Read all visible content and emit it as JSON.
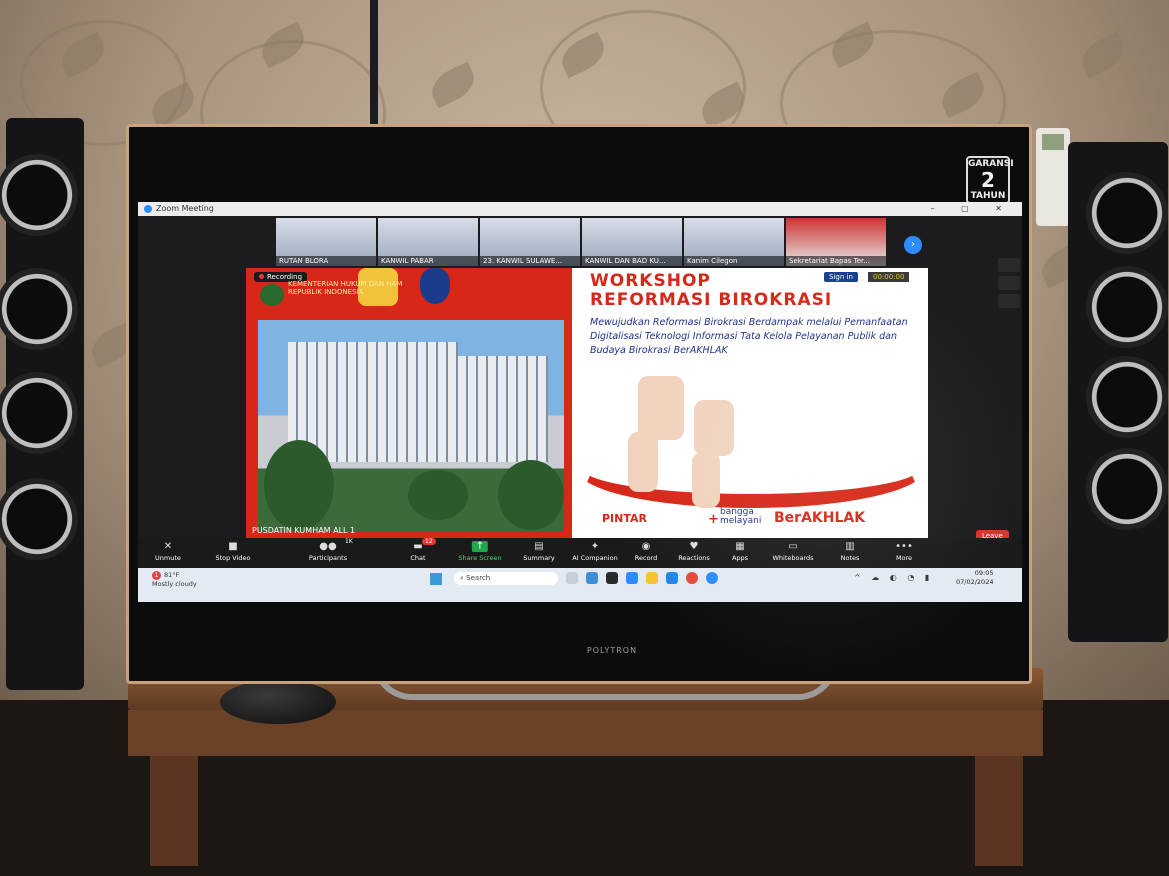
{
  "window": {
    "title": "Zoom Meeting",
    "controls": "– ▢ ✕"
  },
  "warranty": {
    "top": "GARANSI",
    "number": "2",
    "bottom": "TAHUN"
  },
  "tv_brand": "POLYTRON",
  "participants": [
    {
      "name": "RUTAN BLORA"
    },
    {
      "name": "KANWIL PABAR"
    },
    {
      "name": "23. KANWIL SULAWE..."
    },
    {
      "name": "KANWIL DAN BAD KU..."
    },
    {
      "name": "Kanim Cilegon"
    },
    {
      "name": "Sekretariat Bapas Ter..."
    }
  ],
  "slide": {
    "recording_label": "Recording",
    "ministry": "KEMENTERIAN HUKUM DAN HAM REPUBLIK INDONESIA",
    "caption": "PUSDATIN KUMHAM ALL 1",
    "sign_in": "Sign in",
    "timer": "00:00:00",
    "title_line1": "WORKSHOP",
    "title_line2": "REFORMASI BIROKRASI",
    "subtitle": "Mewujudkan Reformasi Birokrasi Berdampak melalui Pemanfaatan Digitalisasi Teknologi Informasi Tata Kelola Pelayanan Publik dan Budaya Birokrasi BerAKHLAK",
    "tag_pintar": "PINTAR",
    "tag_bangga": "bangga",
    "tag_melayani": "melayani",
    "tag_berakhlak": "BerAKHLAK"
  },
  "toolbar": {
    "unmute": "Unmute",
    "stop_video": "Stop Video",
    "participants": "Participants",
    "participants_count": "1K",
    "chat": "Chat",
    "chat_badge": "12",
    "share_screen": "Share Screen",
    "summary": "Summary",
    "ai_companion": "AI Companion",
    "record": "Record",
    "reactions": "Reactions",
    "apps": "Apps",
    "whiteboards": "Whiteboards",
    "notes": "Notes",
    "more": "More",
    "leave": "Leave"
  },
  "taskbar": {
    "weather_temp": "81°F",
    "weather_desc": "Mostly cloudy",
    "weather_badge": "1",
    "search_placeholder": "Search",
    "time": "09:05",
    "date": "07/02/2024"
  },
  "colors": {
    "accent_red": "#d62718",
    "zoom_blue": "#2d8cff",
    "share_green": "#1fa84a",
    "slide_navy": "#1e2f8a"
  }
}
